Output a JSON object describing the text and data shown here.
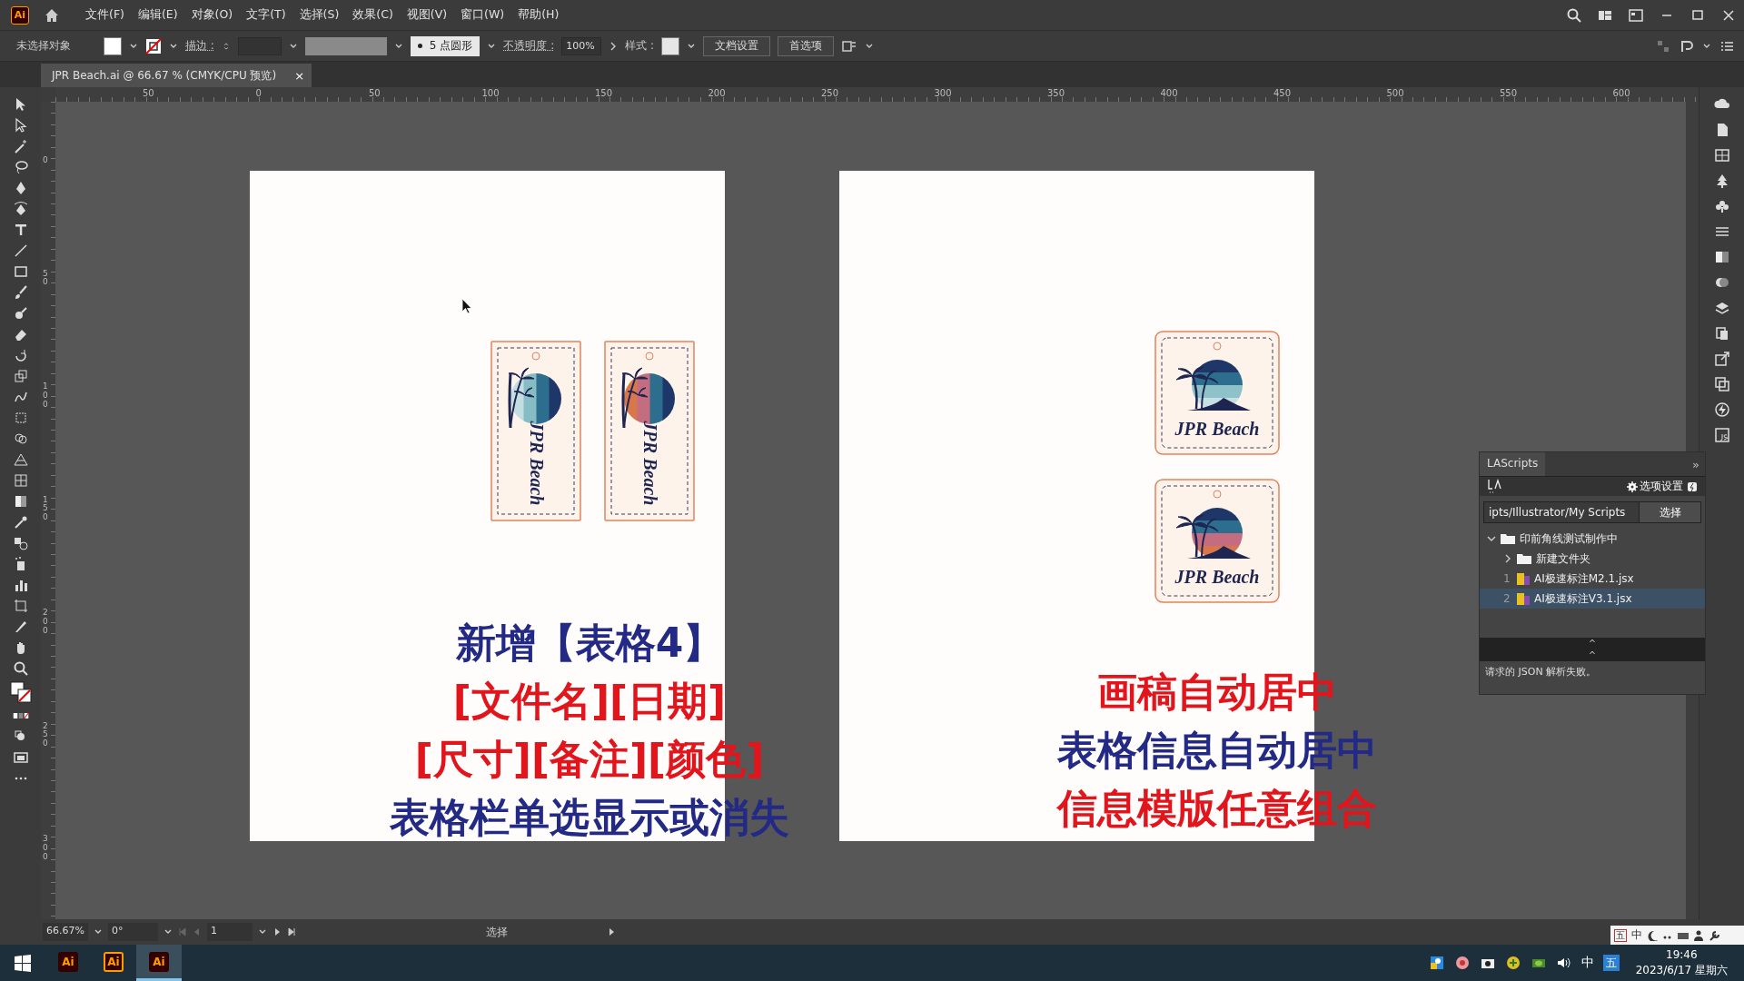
{
  "app": {
    "logo": "Ai"
  },
  "menu": [
    {
      "label": "文件(F)"
    },
    {
      "label": "编辑(E)"
    },
    {
      "label": "对象(O)"
    },
    {
      "label": "文字(T)"
    },
    {
      "label": "选择(S)"
    },
    {
      "label": "效果(C)"
    },
    {
      "label": "视图(V)"
    },
    {
      "label": "窗口(W)"
    },
    {
      "label": "帮助(H)"
    }
  ],
  "control_bar": {
    "selection": "未选择对象",
    "stroke_label": "描边 :",
    "brush": "5 点圆形",
    "opacity_label": "不透明度 :",
    "opacity": "100%",
    "style_label": "样式 :",
    "buttons": [
      "文档设置",
      "首选项"
    ]
  },
  "document_tab": {
    "title": "JPR Beach.ai @ 66.67 % (CMYK/CPU 预览)",
    "close": "×"
  },
  "rulers": {
    "horizontal": [
      "50",
      "0",
      "50",
      "100",
      "150",
      "200",
      "250",
      "300",
      "350",
      "400",
      "450",
      "500",
      "550",
      "600"
    ],
    "vertical": [
      "0",
      "50",
      "100",
      "150",
      "200",
      "250",
      "300"
    ]
  },
  "artboards": [
    {
      "tags": [
        {
          "kind": "tall",
          "text": "JPR Beach",
          "color": "#86bcc3"
        },
        {
          "kind": "tall",
          "text": "JPR Beach",
          "color": "#c56d80"
        }
      ],
      "captions": [
        {
          "text": "新增【表格4】",
          "color": "#232a86"
        },
        {
          "text": "[文件名][日期]",
          "color": "#e2141c"
        },
        {
          "text": "[尺寸][备注][颜色]",
          "color": "#e2141c"
        },
        {
          "text": "表格栏单选显示或消失",
          "color": "#232a86"
        }
      ]
    },
    {
      "tags": [
        {
          "kind": "square",
          "text": "JPR Beach",
          "color": "#8fc1c8"
        },
        {
          "kind": "square",
          "text": "JPR Beach",
          "color": "#c56d80"
        }
      ],
      "captions": [
        {
          "text": "画稿自动居中",
          "color": "#e2141c"
        },
        {
          "text": "表格信息自动居中",
          "color": "#232a86"
        },
        {
          "text": "信息模版任意组合",
          "color": "#e2141c"
        }
      ]
    }
  ],
  "scripts_panel": {
    "title": "LAScripts",
    "collapse": "»",
    "options": "选项设置",
    "path": "ipts/Illustrator/My Scripts",
    "choose": "选择",
    "tree": [
      {
        "kind": "folder",
        "label": "印前角线测试制作中",
        "expanded": true,
        "selected": false,
        "children": [
          {
            "kind": "folder",
            "label": "新建文件夹",
            "expanded": false,
            "selected": false
          },
          {
            "kind": "script",
            "index": "1",
            "label": "AI极速标注M2.1.jsx",
            "selected": false
          },
          {
            "kind": "script",
            "index": "2",
            "label": "AI极速标注V3.1.jsx",
            "selected": true
          }
        ]
      }
    ],
    "splitters": [
      "^",
      "^"
    ],
    "message": "请求的 JSON 解析失败。"
  },
  "status_bar": {
    "zoom": "66.67%",
    "rotation": "0°",
    "artboard": "1",
    "tool": "选择"
  },
  "ime_bar": {
    "mode": "五",
    "language": "中"
  },
  "taskbar": {
    "apps": [
      {
        "label": "Ai",
        "kind": "filled",
        "selected": false
      },
      {
        "label": "Ai",
        "kind": "outline",
        "selected": false
      },
      {
        "label": "Ai",
        "kind": "filled",
        "selected": true
      }
    ],
    "ime_language": "中",
    "ime_mode": "五",
    "time": "19:46",
    "date": "2023/6/17 星期六"
  }
}
